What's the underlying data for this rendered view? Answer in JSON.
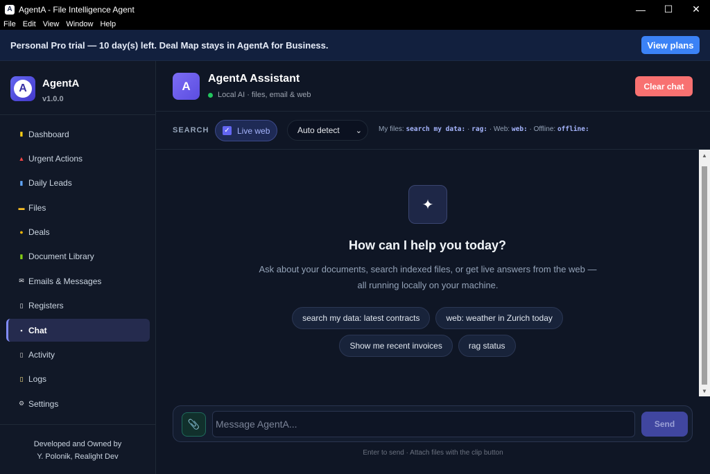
{
  "window": {
    "title": "AgentA - File Intelligence Agent",
    "icon_letter": "A",
    "controls": {
      "minimize": "—",
      "maximize": "☐",
      "close": "✕"
    }
  },
  "menu": [
    "File",
    "Edit",
    "View",
    "Window",
    "Help"
  ],
  "banner": {
    "text": "Personal Pro trial — 10 day(s) left. Deal Map stays in AgentA for Business.",
    "button": "View plans"
  },
  "sidebar": {
    "brand": {
      "name": "AgentA",
      "version": "v1.0.0",
      "logo_letter": "A"
    },
    "items": [
      {
        "label": "Dashboard",
        "icon": "bar-chart-icon",
        "glyph": "▮"
      },
      {
        "label": "Urgent Actions",
        "icon": "siren-icon",
        "glyph": "▲"
      },
      {
        "label": "Daily Leads",
        "icon": "trend-chart-icon",
        "glyph": "▮"
      },
      {
        "label": "Files",
        "icon": "folder-icon",
        "glyph": "▬"
      },
      {
        "label": "Deals",
        "icon": "coin-icon",
        "glyph": "●"
      },
      {
        "label": "Document Library",
        "icon": "books-icon",
        "glyph": "▮"
      },
      {
        "label": "Emails & Messages",
        "icon": "envelope-icon",
        "glyph": "✉"
      },
      {
        "label": "Registers",
        "icon": "ledger-icon",
        "glyph": "▯"
      },
      {
        "label": "Chat",
        "icon": "speech-bubble-icon",
        "glyph": "▪",
        "active": true
      },
      {
        "label": "Activity",
        "icon": "clipboard-icon",
        "glyph": "▯"
      },
      {
        "label": "Logs",
        "icon": "scroll-icon",
        "glyph": "▯"
      },
      {
        "label": "Settings",
        "icon": "gear-icon",
        "glyph": "⚙"
      }
    ],
    "footer": {
      "line1": "Developed and Owned by",
      "line2": "Y. Polonik, Realight Dev"
    }
  },
  "chat": {
    "assistant_initial": "A",
    "title": "AgentA Assistant",
    "status": "Local AI · files, email & web",
    "clear_button": "Clear chat",
    "search": {
      "label": "SEARCH",
      "live_web": "Live web",
      "live_web_checked": true,
      "mode": "Auto detect",
      "hints": {
        "my_files_label": "My files:",
        "my_files_cmd": "search my data:",
        "rag_cmd": "rag:",
        "web_label": "Web:",
        "web_cmd": "web:",
        "offline_label": "Offline:",
        "offline_cmd": "offline:"
      }
    },
    "empty_state": {
      "icon": "✦",
      "title": "How can I help you today?",
      "description": "Ask about your documents, search indexed files, or get live answers from the web — all running locally on your machine.",
      "suggestions_row1": [
        "search my data: latest contracts",
        "web: weather in Zurich today"
      ],
      "suggestions_row2": [
        "Show me recent invoices",
        "rag status"
      ]
    },
    "composer": {
      "attach_icon": "📎",
      "placeholder": "Message AgentA...",
      "send": "Send",
      "hint": "Enter to send · Attach files with the clip button"
    }
  },
  "colors": {
    "accent": "#3b82f6",
    "danger": "#f87171",
    "online": "#22c55e",
    "indigo": "#6366f1"
  }
}
